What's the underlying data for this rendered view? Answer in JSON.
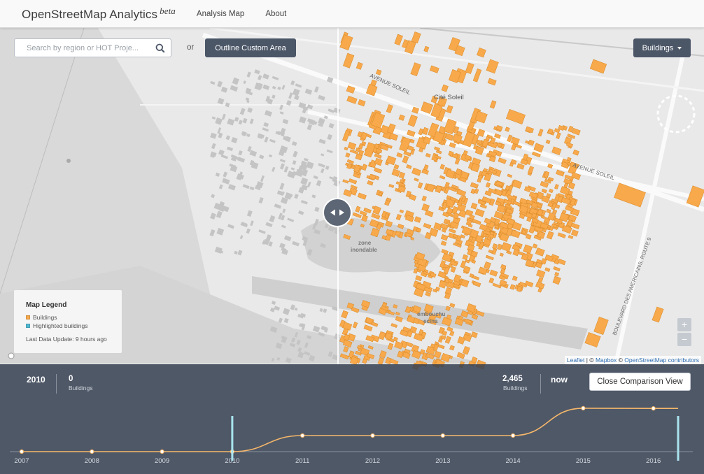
{
  "navbar": {
    "brand": "OpenStreetMap Analytics",
    "brand_suffix": "beta",
    "links": [
      "Analysis Map",
      "About"
    ]
  },
  "search": {
    "placeholder": "Search by region or HOT Proje..."
  },
  "or_label": "or",
  "outline_button": "Outline Custom Area",
  "layer_button": "Buildings",
  "map_labels": {
    "avenue_soleil_1": "AVENUE SOLEIL",
    "avenue_soleil_2": "AVENUE SOLEIL",
    "cite_soleil": "Cité Soleil",
    "zone_1": "zone",
    "zone_2": "inondable",
    "embouch_1": "embouchu",
    "embouch_2": "ecina",
    "boulevard": "BOULEVARD DES AMERICAINS, ROUTE 9"
  },
  "legend": {
    "title": "Map Legend",
    "items": [
      {
        "label": "Buildings",
        "color": "#f7a94b"
      },
      {
        "label": "Highlighted buildings",
        "color": "#4fb8d1"
      }
    ],
    "last_update": "Last Data Update: 9 hours ago"
  },
  "zoom": {
    "plus": "+",
    "minus": "−"
  },
  "attribution": {
    "leaflet": "Leaflet",
    "sep1": " | © ",
    "mapbox": "Mapbox",
    "sep2": " © ",
    "osm": "OpenStreetMap contributors"
  },
  "comparison": {
    "left_year": "2010",
    "left_count": "0",
    "left_unit": "Buildings",
    "right_count": "2,465",
    "right_unit": "Buildings",
    "right_year": "now",
    "close_button": "Close Comparison View"
  },
  "colors": {
    "building": "#f7a94b",
    "panel": "#364052",
    "timeline_line": "#f5b76a",
    "handle": "#a9e3ee"
  },
  "chart_data": {
    "type": "line",
    "title": "",
    "xlabel": "",
    "ylabel": "",
    "categories": [
      "2007",
      "2008",
      "2009",
      "2010",
      "2011",
      "2012",
      "2013",
      "2014",
      "2015",
      "2016"
    ],
    "series": [
      {
        "values": [
          0,
          0,
          0,
          0,
          900,
          900,
          900,
          900,
          2430,
          2420
        ]
      }
    ],
    "current_value": 2465,
    "ylim": [
      0,
      2700
    ],
    "selection": [
      "2010",
      "now"
    ]
  }
}
